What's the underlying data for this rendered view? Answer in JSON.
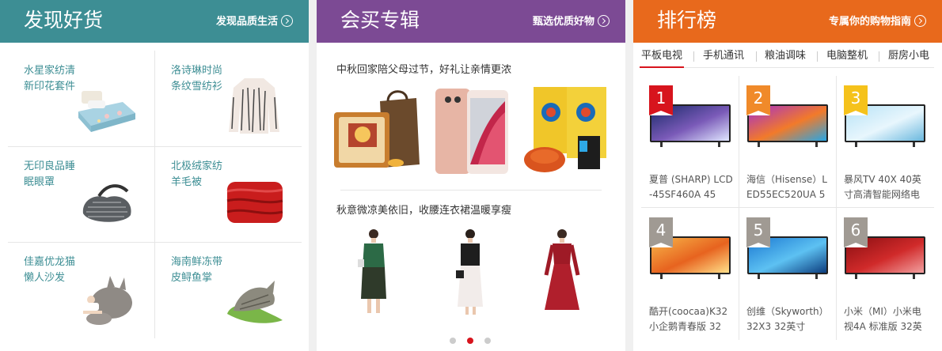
{
  "panels": {
    "discover": {
      "title": "发现好货",
      "more": "发现品质生活",
      "items": [
        {
          "line1": "水星家纺清",
          "line2": "新印花套件",
          "icon": "bedding-set"
        },
        {
          "line1": "洛诗琳时尚",
          "line2": "条纹雪纺衫",
          "icon": "striped-blouse"
        },
        {
          "line1": "无印良品睡",
          "line2": "眠眼罩",
          "icon": "eye-mask"
        },
        {
          "line1": "北极绒家纺",
          "line2": "羊毛被",
          "icon": "red-quilt"
        },
        {
          "line1": "佳嘉优龙猫",
          "line2": "懒人沙发",
          "icon": "bean-bag"
        },
        {
          "line1": "海南鲜冻带",
          "line2": "皮鲟鱼掌",
          "icon": "fish"
        }
      ]
    },
    "shopping": {
      "title": "会买专辑",
      "more": "甄选优质好物",
      "section1": "中秋回家陪父母过节，好礼让亲情更浓",
      "section2": "秋意微凉美依旧，收腰连衣裙温暖享瘦"
    },
    "ranking": {
      "title": "排行榜",
      "more": "专属你的购物指南",
      "tabs": [
        "平板电视",
        "手机通讯",
        "粮油调味",
        "电脑整机",
        "厨房小电"
      ],
      "items": [
        {
          "rank": "1",
          "name": "夏普 (SHARP) LCD-45SF460A 45",
          "badge_color": "#d7141d"
        },
        {
          "rank": "2",
          "name": "海信（Hisense）LED55EC520UA 5",
          "badge_color": "#f08a2a"
        },
        {
          "rank": "3",
          "name": "暴风TV 40X 40英寸高清智能网络电",
          "badge_color": "#f5c21b"
        },
        {
          "rank": "4",
          "name": "酷开(coocaa)K32 小企鹅青春版 32",
          "badge_color": "#a09a93"
        },
        {
          "rank": "5",
          "name": "创维（Skyworth）32X3 32英寸",
          "badge_color": "#a09a93"
        },
        {
          "rank": "6",
          "name": "小米（MI）小米电视4A 标准版 32英",
          "badge_color": "#a09a93"
        }
      ]
    }
  },
  "colors": {
    "teal": "#3d8e94",
    "purple": "#7c4a94",
    "orange": "#e8691c",
    "red": "#d7141d"
  }
}
